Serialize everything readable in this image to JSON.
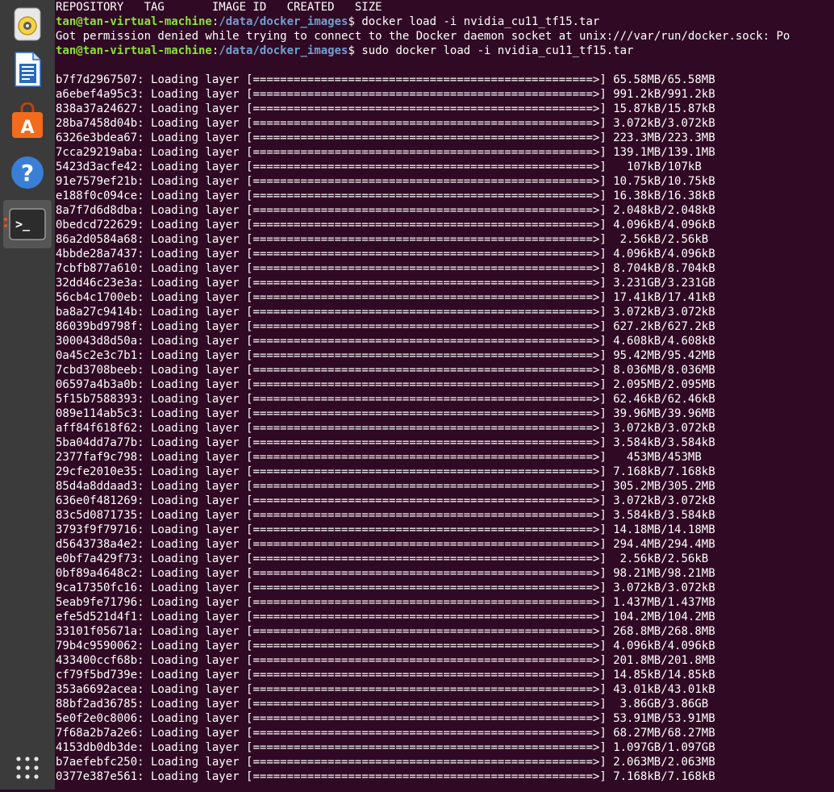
{
  "dock": {
    "items": [
      {
        "name": "rhythmbox-icon"
      },
      {
        "name": "libreoffice-writer-icon"
      },
      {
        "name": "software-center-icon"
      },
      {
        "name": "help-icon"
      },
      {
        "name": "terminal-icon",
        "active": true
      },
      {
        "name": "show-applications-icon"
      }
    ],
    "help_glyph": "?",
    "terminal_glyph": ">_",
    "software_glyph": "A"
  },
  "terminal": {
    "header": "REPOSITORY   TAG       IMAGE ID   CREATED   SIZE",
    "prompt_user": "tan@tan-virtual-machine",
    "prompt_sep": ":",
    "prompt_path": "/data/docker_images",
    "prompt_suffix": "$ ",
    "command1": "docker load -i nvidia_cu11_tf15.tar",
    "error": "Got permission denied while trying to connect to the Docker daemon socket at unix:///var/run/docker.sock: Po",
    "command2": "sudo docker load -i nvidia_cu11_tf15.tar",
    "progress_bar": "[==================================================>]",
    "loading_label": "Loading layer",
    "layers": [
      {
        "id": "b7f7d2967507",
        "size": " 65.58MB/65.58MB"
      },
      {
        "id": "a6ebef4a95c3",
        "size": " 991.2kB/991.2kB"
      },
      {
        "id": "838a37a24627",
        "size": " 15.87kB/15.87kB"
      },
      {
        "id": "28ba7458d04b",
        "size": " 3.072kB/3.072kB"
      },
      {
        "id": "6326e3bdea67",
        "size": " 223.3MB/223.3MB"
      },
      {
        "id": "7cca29219aba",
        "size": " 139.1MB/139.1MB"
      },
      {
        "id": "5423d3acfe42",
        "size": "   107kB/107kB"
      },
      {
        "id": "91e7579ef21b",
        "size": " 10.75kB/10.75kB"
      },
      {
        "id": "e188f0c094ce",
        "size": " 16.38kB/16.38kB"
      },
      {
        "id": "8a7f7d6d8dba",
        "size": " 2.048kB/2.048kB"
      },
      {
        "id": "0bedcd722629",
        "size": " 4.096kB/4.096kB"
      },
      {
        "id": "86a2d0584a68",
        "size": "  2.56kB/2.56kB"
      },
      {
        "id": "4bbde28a7437",
        "size": " 4.096kB/4.096kB"
      },
      {
        "id": "7cbfb877a610",
        "size": " 8.704kB/8.704kB"
      },
      {
        "id": "32dd46c23e3a",
        "size": " 3.231GB/3.231GB"
      },
      {
        "id": "56cb4c1700eb",
        "size": " 17.41kB/17.41kB"
      },
      {
        "id": "ba8a27c9414b",
        "size": " 3.072kB/3.072kB"
      },
      {
        "id": "86039bd9798f",
        "size": " 627.2kB/627.2kB"
      },
      {
        "id": "300043d8d50a",
        "size": " 4.608kB/4.608kB"
      },
      {
        "id": "0a45c2e3c7b1",
        "size": " 95.42MB/95.42MB"
      },
      {
        "id": "7cbd3708beeb",
        "size": " 8.036MB/8.036MB"
      },
      {
        "id": "06597a4b3a0b",
        "size": " 2.095MB/2.095MB"
      },
      {
        "id": "5f15b7588393",
        "size": " 62.46kB/62.46kB"
      },
      {
        "id": "089e114ab5c3",
        "size": " 39.96MB/39.96MB"
      },
      {
        "id": "aff84f618f62",
        "size": " 3.072kB/3.072kB"
      },
      {
        "id": "5ba04dd7a77b",
        "size": " 3.584kB/3.584kB"
      },
      {
        "id": "2377faf9c798",
        "size": "   453MB/453MB"
      },
      {
        "id": "29cfe2010e35",
        "size": " 7.168kB/7.168kB"
      },
      {
        "id": "85d4a8ddaad3",
        "size": " 305.2MB/305.2MB"
      },
      {
        "id": "636e0f481269",
        "size": " 3.072kB/3.072kB"
      },
      {
        "id": "83c5d0871735",
        "size": " 3.584kB/3.584kB"
      },
      {
        "id": "3793f9f79716",
        "size": " 14.18MB/14.18MB"
      },
      {
        "id": "d5643738a4e2",
        "size": " 294.4MB/294.4MB"
      },
      {
        "id": "e0bf7a429f73",
        "size": "  2.56kB/2.56kB"
      },
      {
        "id": "0bf89a4648c2",
        "size": " 98.21MB/98.21MB"
      },
      {
        "id": "9ca17350fc16",
        "size": " 3.072kB/3.072kB"
      },
      {
        "id": "5eab9fe71796",
        "size": " 1.437MB/1.437MB"
      },
      {
        "id": "efe5d521d4f1",
        "size": " 104.2MB/104.2MB"
      },
      {
        "id": "33101f05671a",
        "size": " 268.8MB/268.8MB"
      },
      {
        "id": "79b4c9590062",
        "size": " 4.096kB/4.096kB"
      },
      {
        "id": "433400ccf68b",
        "size": " 201.8MB/201.8MB"
      },
      {
        "id": "cf79f5bd739e",
        "size": " 14.85kB/14.85kB"
      },
      {
        "id": "353a6692acea",
        "size": " 43.01kB/43.01kB"
      },
      {
        "id": "88bf2ad36785",
        "size": "  3.86GB/3.86GB"
      },
      {
        "id": "5e0f2e0c8006",
        "size": " 53.91MB/53.91MB"
      },
      {
        "id": "7f68a2b7a2e6",
        "size": " 68.27MB/68.27MB"
      },
      {
        "id": "4153db0db3de",
        "size": " 1.097GB/1.097GB"
      },
      {
        "id": "b7aefebfc250",
        "size": " 2.063MB/2.063MB"
      },
      {
        "id": "0377e387e561",
        "size": " 7.168kB/7.168kB"
      }
    ]
  },
  "colors": {
    "terminal_bg": "#300a24",
    "prompt_user": "#8ae234",
    "prompt_path": "#729fcf",
    "dock_bg": "#3b3b3b"
  }
}
